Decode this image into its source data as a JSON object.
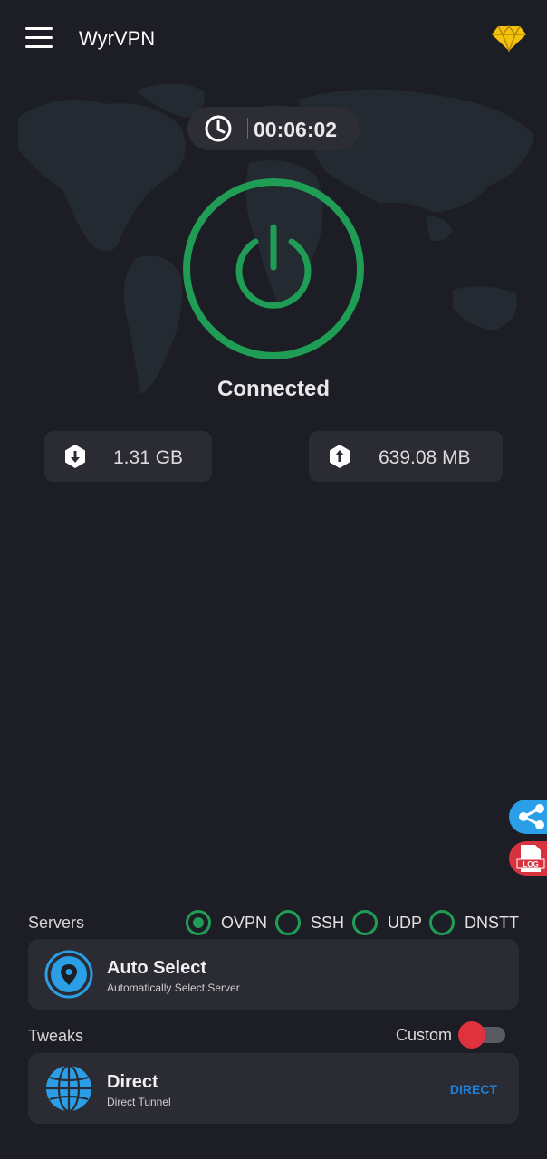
{
  "app": {
    "title": "WyrVPN"
  },
  "icons": {
    "menu": "hamburger-menu-icon",
    "premium": "diamond-icon",
    "timer": "clock-icon",
    "power": "power-icon",
    "download": "download-icon",
    "upload": "upload-icon",
    "share": "share-icon",
    "log": "log-file-icon",
    "server": "location-pin-icon",
    "tweak": "globe-icon"
  },
  "colors": {
    "background": "#1c1d25",
    "accent_green": "#1f9d55",
    "premium_gold": "#f4c20d",
    "share_blue": "#2a9ee6",
    "log_red": "#d7323d",
    "direct_blue": "#1e7fd9",
    "toggle_thumb": "#e0313f"
  },
  "connection": {
    "elapsed": "00:06:02",
    "status": "Connected",
    "download": "1.31 GB",
    "upload": "639.08 MB"
  },
  "servers": {
    "label": "Servers",
    "protocols": [
      {
        "label": "OVPN",
        "selected": true
      },
      {
        "label": "SSH",
        "selected": false
      },
      {
        "label": "UDP",
        "selected": false
      },
      {
        "label": "DNSTT",
        "selected": false
      }
    ],
    "selected_server": {
      "title": "Auto Select",
      "subtitle": "Automatically Select Server"
    }
  },
  "tweaks": {
    "label": "Tweaks",
    "custom_label": "Custom",
    "custom_enabled": false,
    "selected_tweak": {
      "title": "Direct",
      "subtitle": "Direct Tunnel",
      "tag": "DIRECT"
    }
  },
  "side_buttons": {
    "log_label": "LOG"
  }
}
